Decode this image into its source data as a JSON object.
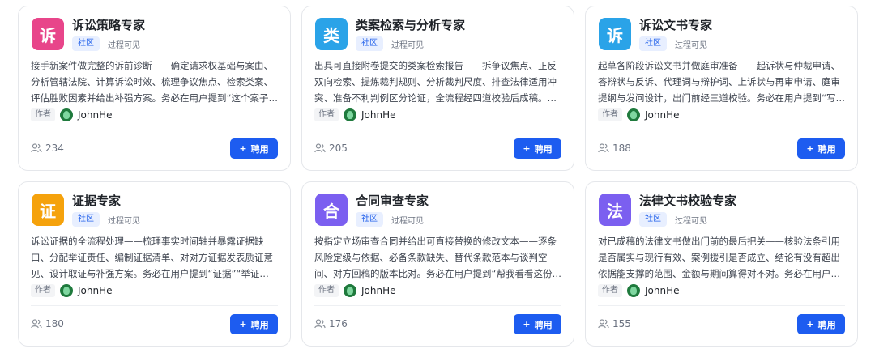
{
  "cards": [
    {
      "icon_char": "诉",
      "icon_color": "#e8458a",
      "title": "诉讼策略专家",
      "badge": "社区",
      "visibility": "过程可见",
      "description": "接手新案件做完整的诉前诊断——确定请求权基础与案由、分析管辖法院、计算诉讼时效、梳理争议焦点、检索类案、评估胜败因素并给出补强方案。务必在用户提到“这个案子…",
      "author_tag": "作者",
      "author_name": "JohnHe",
      "count": "234",
      "button_label": "聘用"
    },
    {
      "icon_char": "类",
      "icon_color": "#2aa3e8",
      "title": "类案检索与分析专家",
      "badge": "社区",
      "visibility": "过程可见",
      "description": "出具可直接附卷提交的类案检索报告——拆争议焦点、正反双向检索、提炼裁判规则、分析裁判尺度、排查法律适用冲突、准备不利判例区分论证，全流程经四道校验后成稿。…",
      "author_tag": "作者",
      "author_name": "JohnHe",
      "count": "205",
      "button_label": "聘用"
    },
    {
      "icon_char": "诉",
      "icon_color": "#2aa3e8",
      "title": "诉讼文书专家",
      "badge": "社区",
      "visibility": "过程可见",
      "description": "起草各阶段诉讼文书并做庭审准备——起诉状与仲裁申请、答辩状与反诉、代理词与辩护词、上诉状与再审申请、庭审提纲与发问设计，出门前经三道校验。务必在用户提到“写…",
      "author_tag": "作者",
      "author_name": "JohnHe",
      "count": "188",
      "button_label": "聘用"
    },
    {
      "icon_char": "证",
      "icon_color": "#f5a20c",
      "title": "证据专家",
      "badge": "社区",
      "visibility": "过程可见",
      "description": "诉讼证据的全流程处理——梳理事实时间轴并暴露证据缺口、分配举证责任、编制证据清单、对对方证据发表质证意见、设计取证与补强方案。务必在用户提到“证据”“举证责…",
      "author_tag": "作者",
      "author_name": "JohnHe",
      "count": "180",
      "button_label": "聘用"
    },
    {
      "icon_char": "合",
      "icon_color": "#7b5ff0",
      "title": "合同审查专家",
      "badge": "社区",
      "visibility": "过程可见",
      "description": "按指定立场审查合同并给出可直接替换的修改文本——逐条风险定级与依据、必备条款缺失、替代条款范本与谈判空间、对方回稿的版本比对。务必在用户提到“帮我看看这份…",
      "author_tag": "作者",
      "author_name": "JohnHe",
      "count": "176",
      "button_label": "聘用"
    },
    {
      "icon_char": "法",
      "icon_color": "#7b5ff0",
      "title": "法律文书校验专家",
      "badge": "社区",
      "visibility": "过程可见",
      "description": "对已成稿的法律文书做出门前的最后把关——核验法条引用是否属实与现行有效、案例援引是否成立、结论有没有超出依据能支撑的范围、金额与期间算得对不对。务必在用户…",
      "author_tag": "作者",
      "author_name": "JohnHe",
      "count": "155",
      "button_label": "聘用"
    }
  ]
}
